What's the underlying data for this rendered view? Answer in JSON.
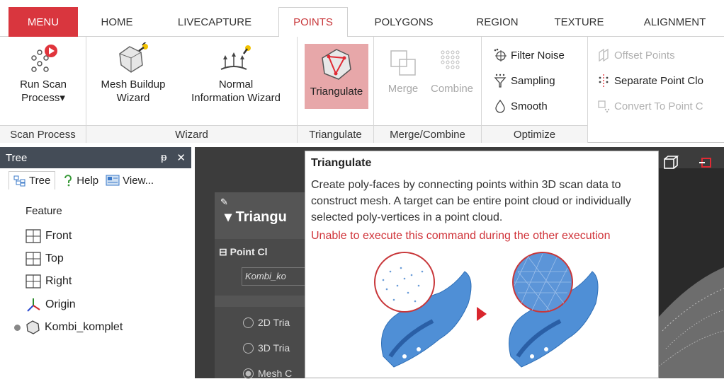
{
  "tabs": [
    {
      "label": "MENU"
    },
    {
      "label": "HOME"
    },
    {
      "label": "LIVECAPTURE"
    },
    {
      "label": "POINTS"
    },
    {
      "label": "POLYGONS"
    },
    {
      "label": "REGION"
    },
    {
      "label": "TEXTURE"
    },
    {
      "label": "ALIGNMENT"
    }
  ],
  "ribbon": {
    "scan_process": {
      "run_scan": "Run Scan",
      "process": "Process▾",
      "group": "Scan Process"
    },
    "wizard": {
      "mesh_buildup_1": "Mesh Buildup",
      "mesh_buildup_2": "Wizard",
      "normal_1": "Normal",
      "normal_2": "Information Wizard",
      "group": "Wizard"
    },
    "triangulate": {
      "label": "Triangulate",
      "group": "Triangulate"
    },
    "merge_combine": {
      "merge": "Merge",
      "combine": "Combine",
      "group": "Merge/Combine"
    },
    "optimize": {
      "filter_noise": "Filter Noise",
      "sampling": "Sampling",
      "smooth": "Smooth",
      "group": "Optimize"
    },
    "extra": {
      "offset_points": "Offset Points",
      "separate_point_cloud": "Separate Point Clo",
      "convert_to_point": "Convert To Point C"
    }
  },
  "tree": {
    "title": "Tree",
    "pin": "ᵽ",
    "close": "✕",
    "tabs": {
      "tree": "Tree",
      "help": "Help",
      "view": "View..."
    },
    "feature": "Feature",
    "items": {
      "front": "Front",
      "top": "Top",
      "right": "Right",
      "origin": "Origin",
      "kombi": "Kombi_komplet"
    }
  },
  "panel": {
    "title": "Triangu",
    "section": "Point Cl",
    "field_value": "Kombi_ko",
    "option_2d": "2D Tria",
    "option_3d": "3D Tria",
    "option_mesh": "Mesh C"
  },
  "tooltip": {
    "title": "Triangulate",
    "description": "Create poly-faces by connecting points within 3D scan data to construct mesh. A target can be entire point cloud or individually selected poly-vertices in a point cloud.",
    "warning": "Unable to execute this command during the other execution"
  },
  "colors": {
    "menu_red": "#d9363e",
    "active_tab_text": "#c8373a",
    "warning_red": "#d0343a",
    "model_blue": "#4f8fd6"
  }
}
